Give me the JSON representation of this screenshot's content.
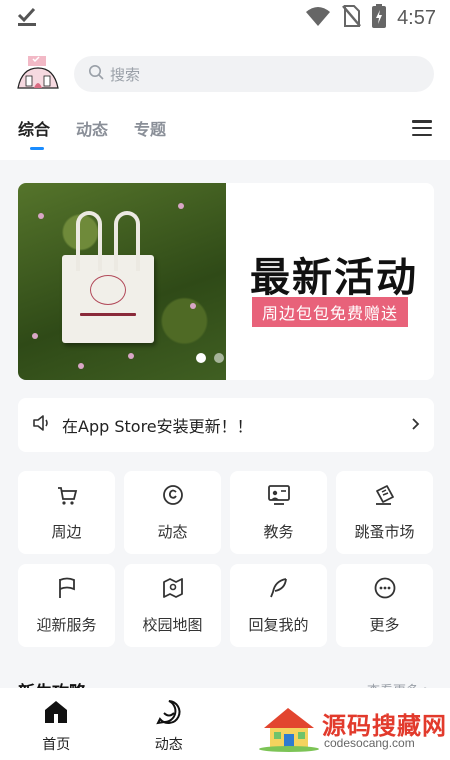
{
  "status_bar": {
    "time": "4:57"
  },
  "search": {
    "placeholder": "搜索"
  },
  "tabs": [
    {
      "label": "综合",
      "active": true
    },
    {
      "label": "动态",
      "active": false
    },
    {
      "label": "专题",
      "active": false
    }
  ],
  "banner": {
    "title": "最新活动",
    "subtitle": "周边包包免费赠送",
    "slide_count": 2,
    "active_slide": 1
  },
  "notice": {
    "text": "在App Store安装更新！！"
  },
  "grid_items": [
    {
      "label": "周边",
      "icon": "cart-icon"
    },
    {
      "label": "动态",
      "icon": "at-sign-icon"
    },
    {
      "label": "教务",
      "icon": "teacher-board-icon"
    },
    {
      "label": "跳蚤市场",
      "icon": "ticket-icon"
    },
    {
      "label": "迎新服务",
      "icon": "flag-icon"
    },
    {
      "label": "校园地图",
      "icon": "map-icon"
    },
    {
      "label": "回复我的",
      "icon": "feather-icon"
    },
    {
      "label": "更多",
      "icon": "more-dots-icon"
    }
  ],
  "section": {
    "title": "新生攻略",
    "more": "查看更多 >"
  },
  "bottom_nav": [
    {
      "label": "首页",
      "icon": "home-icon",
      "active": true
    },
    {
      "label": "动态",
      "icon": "chat-bubble-icon",
      "active": false
    }
  ],
  "watermark": {
    "title": "源码搜藏网",
    "url": "codesocang.com"
  },
  "colors": {
    "accent": "#1a8cff",
    "ribbon": "#e8627a",
    "watermark": "#e23a2c"
  }
}
